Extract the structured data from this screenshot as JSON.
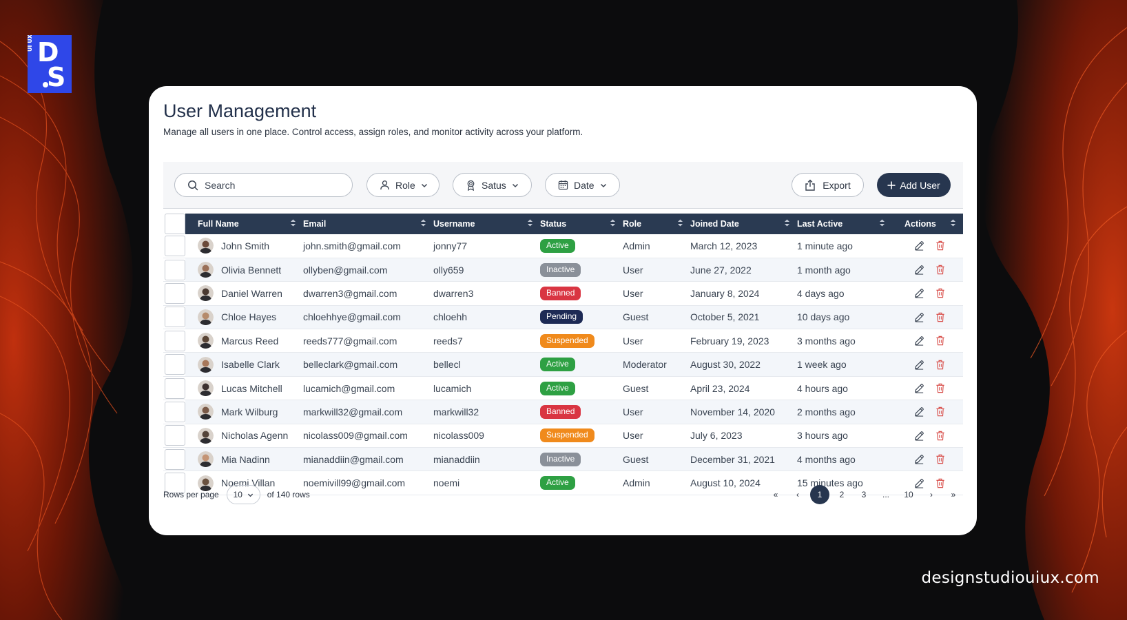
{
  "brand": {
    "logo_text": "D.S",
    "logo_side_text": "UI UX"
  },
  "site_url": "designstudiouiux.com",
  "header": {
    "title": "User Management",
    "subtitle": "Manage all users in one place. Control access, assign roles, and monitor activity across your platform."
  },
  "toolbar": {
    "search_placeholder": "Search",
    "filters": {
      "role": "Role",
      "status": "Satus",
      "date": "Date"
    },
    "export_label": "Export",
    "add_user_label": "Add User"
  },
  "table": {
    "headers": {
      "full_name": "Full Name",
      "email": "Email",
      "username": "Username",
      "status": "Status",
      "role": "Role",
      "joined": "Joined Date",
      "last_active": "Last Active",
      "actions": "Actions"
    },
    "rows": [
      {
        "name": "John Smith",
        "email": "john.smith@gmail.com",
        "username": "jonny77",
        "status": "Active",
        "role": "Admin",
        "joined": "March 12, 2023",
        "last_active": "1 minute ago"
      },
      {
        "name": "Olivia Bennett",
        "email": "ollyben@gmail.com",
        "username": "olly659",
        "status": "Inactive",
        "role": "User",
        "joined": "June 27, 2022",
        "last_active": "1 month ago"
      },
      {
        "name": "Daniel Warren",
        "email": "dwarren3@gmail.com",
        "username": "dwarren3",
        "status": "Banned",
        "role": "User",
        "joined": "January 8, 2024",
        "last_active": "4 days ago"
      },
      {
        "name": "Chloe Hayes",
        "email": "chloehhye@gmail.com",
        "username": "chloehh",
        "status": "Pending",
        "role": "Guest",
        "joined": "October 5, 2021",
        "last_active": "10 days ago"
      },
      {
        "name": "Marcus Reed",
        "email": "reeds777@gmail.com",
        "username": "reeds7",
        "status": "Suspended",
        "role": "User",
        "joined": "February 19, 2023",
        "last_active": "3 months ago"
      },
      {
        "name": "Isabelle Clark",
        "email": "belleclark@gmail.com",
        "username": "bellecl",
        "status": "Active",
        "role": "Moderator",
        "joined": "August 30, 2022",
        "last_active": "1 week ago"
      },
      {
        "name": "Lucas Mitchell",
        "email": "lucamich@gmail.com",
        "username": "lucamich",
        "status": "Active",
        "role": "Guest",
        "joined": "April 23, 2024",
        "last_active": "4 hours ago"
      },
      {
        "name": "Mark Wilburg",
        "email": "markwill32@gmail.com",
        "username": "markwill32",
        "status": "Banned",
        "role": "User",
        "joined": "November 14, 2020",
        "last_active": "2 months ago"
      },
      {
        "name": "Nicholas Agenn",
        "email": "nicolass009@gmail.com",
        "username": "nicolass009",
        "status": "Suspended",
        "role": "User",
        "joined": "July 6, 2023",
        "last_active": "3 hours ago"
      },
      {
        "name": "Mia Nadinn",
        "email": "mianaddiin@gmail.com",
        "username": "mianaddiin",
        "status": "Inactive",
        "role": "Guest",
        "joined": "December 31, 2021",
        "last_active": "4 months ago"
      },
      {
        "name": "Noemi Villan",
        "email": "noemivill99@gmail.com",
        "username": "noemi",
        "status": "Active",
        "role": "Admin",
        "joined": "August 10, 2024",
        "last_active": "15 minutes ago"
      }
    ]
  },
  "status_colors": {
    "Active": "#2ea043",
    "Inactive": "#8a9099",
    "Banned": "#d93542",
    "Pending": "#1d2a55",
    "Suspended": "#f08a1c"
  },
  "avatar_colors": [
    "#6b4a3a",
    "#9a7058",
    "#4a3a32",
    "#b58a6a",
    "#5a4536",
    "#a8785a",
    "#3e3230",
    "#7a5a48",
    "#54443a",
    "#c49474",
    "#6a5240"
  ],
  "pagination": {
    "rows_per_page_label": "Rows per page",
    "rows_per_page_value": "10",
    "total_label": "of 140 rows",
    "first": "«",
    "prev": "‹",
    "pages": [
      "1",
      "2",
      "3",
      "...",
      "10"
    ],
    "active_page": "1",
    "next": "›",
    "last": "»"
  },
  "icons": {
    "search": "search-icon",
    "role": "user-icon",
    "status": "badge-icon",
    "date": "calendar-icon",
    "export": "export-icon",
    "add": "plus-icon",
    "edit": "pencil-icon",
    "delete": "trash-icon",
    "sort": "sort-icon",
    "chevron": "chevron-down-icon"
  },
  "colors": {
    "accent": "#27364f",
    "header_bg": "#2a3a52",
    "delete": "#d9534f",
    "brand_blue": "#2f47e8"
  }
}
